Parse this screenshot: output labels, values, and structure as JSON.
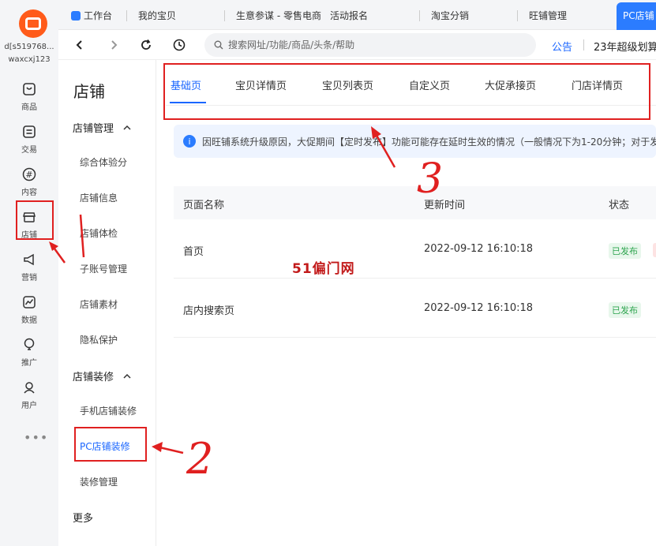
{
  "rail": {
    "account_id": "d[s519768...",
    "account_name": "waxcxj123",
    "items": [
      {
        "label": "商品",
        "icon": "product-icon"
      },
      {
        "label": "交易",
        "icon": "trade-icon"
      },
      {
        "label": "内容",
        "icon": "content-hash-icon"
      },
      {
        "label": "店铺",
        "icon": "shop-icon"
      },
      {
        "label": "营销",
        "icon": "megaphone-icon"
      },
      {
        "label": "数据",
        "icon": "chart-icon"
      },
      {
        "label": "推广",
        "icon": "bulb-icon"
      },
      {
        "label": "用户",
        "icon": "user-icon"
      }
    ],
    "more": "•••"
  },
  "top_tabs": [
    "工作台",
    "我的宝贝",
    "生意参谋 - 零售电商",
    "活动报名",
    "淘宝分销",
    "旺铺管理"
  ],
  "active_tab": "PC店铺",
  "address": {
    "placeholder": "搜索网址/功能/商品/头条/帮助",
    "notice_label": "公告",
    "notice_text": "23年超级划算"
  },
  "subnav": {
    "title": "店铺",
    "group1": "店铺管理",
    "group1_items": [
      "综合体验分",
      "店铺信息",
      "店铺体检",
      "子账号管理",
      "店铺素材",
      "隐私保护"
    ],
    "group2": "店铺装修",
    "group2_items": [
      "手机店铺装修",
      "PC店铺装修",
      "装修管理"
    ],
    "more": "更多"
  },
  "page_tabs": [
    "基础页",
    "宝贝详情页",
    "宝贝列表页",
    "自定义页",
    "大促承接页",
    "门店详情页"
  ],
  "info_banner": "因旺铺系统升级原因，大促期间【定时发布】功能可能存在延时生效的情况（一般情况下为1-20分钟；对于发",
  "table": {
    "headers": [
      "页面名称",
      "更新时间",
      "状态"
    ],
    "rows": [
      {
        "name": "首页",
        "time": "2022-09-12 16:10:18",
        "status": "已发布"
      },
      {
        "name": "店内搜索页",
        "time": "2022-09-12 16:10:18",
        "status": "已发布"
      }
    ]
  },
  "watermark": "51偏门网",
  "annotations": {
    "marker2": "2",
    "marker3": "3"
  },
  "colors": {
    "accent": "#1a66ff",
    "brand": "#ff5b1a",
    "annotation": "#e02020",
    "published": "#2da44e"
  }
}
